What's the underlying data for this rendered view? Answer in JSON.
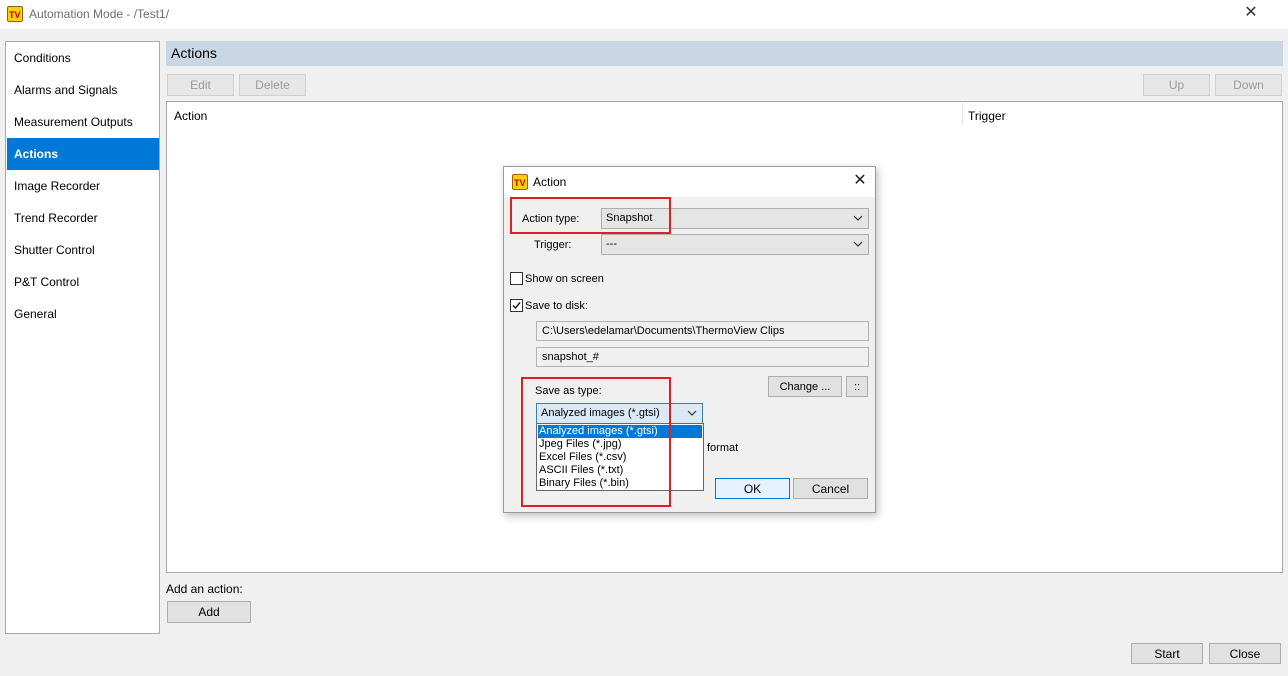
{
  "window": {
    "title": "Automation Mode - /Test1/",
    "app_icon": "tv-app-icon",
    "close_glyph": "✕"
  },
  "nav": {
    "items": [
      {
        "label": "Conditions",
        "selected": false
      },
      {
        "label": "Alarms and Signals",
        "selected": false
      },
      {
        "label": "Measurement Outputs",
        "selected": false
      },
      {
        "label": "Actions",
        "selected": true
      },
      {
        "label": "Image Recorder",
        "selected": false
      },
      {
        "label": "Trend Recorder",
        "selected": false
      },
      {
        "label": "Shutter Control",
        "selected": false
      },
      {
        "label": "P&T Control",
        "selected": false
      },
      {
        "label": "General",
        "selected": false
      }
    ]
  },
  "main": {
    "title": "Actions",
    "toolbar": {
      "edit": "Edit",
      "delete": "Delete",
      "up": "Up",
      "down": "Down"
    },
    "list": {
      "columns": [
        "Action",
        "Trigger"
      ],
      "rows": []
    },
    "add_label": "Add an action:",
    "add_button": "Add"
  },
  "footer": {
    "start": "Start",
    "close": "Close"
  },
  "dialog": {
    "title": "Action",
    "close_glyph": "✕",
    "action_type_label": "Action type:",
    "action_type_value": "Snapshot",
    "trigger_label": "Trigger:",
    "trigger_value": "---",
    "show_on_screen_label": "Show on screen",
    "show_on_screen_checked": false,
    "save_to_disk_label": "Save to disk:",
    "save_to_disk_checked": true,
    "path": "C:\\Users\\edelamar\\Documents\\ThermoView Clips",
    "filename": "snapshot_#",
    "change_button": "Change ...",
    "extra_button": "::",
    "save_as_type_label": "Save as type:",
    "save_as_type_value": "Analyzed images (*.gtsi)",
    "save_as_type_options": [
      "Analyzed images (*.gtsi)",
      "Jpeg Files (*.jpg)",
      "Excel Files (*.csv)",
      "ASCII Files (*.txt)",
      "Binary Files (*.bin)"
    ],
    "partial_label": "format",
    "ok": "OK",
    "cancel": "Cancel"
  },
  "colors": {
    "accent": "#0078d7",
    "highlight": "#e02020",
    "header_band": "#c9d6e3"
  }
}
